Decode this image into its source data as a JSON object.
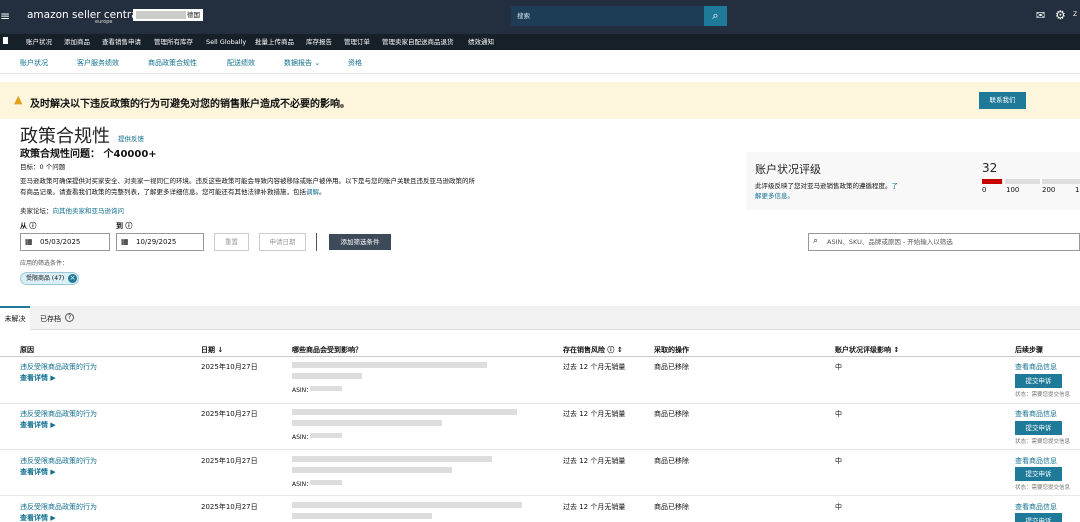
{
  "topbar": {
    "brand": "amazon seller central",
    "brand_sub": "europe",
    "account_country": "德国",
    "search_placeholder": "搜索",
    "user_initial": "Z"
  },
  "nav": [
    "账户状况",
    "添加商品",
    "查看销售申请",
    "管理所有库存",
    "Sell Globally",
    "批量上传商品",
    "库存报告",
    "管理订单",
    "管理卖家自配送商品退货",
    "绩效通知"
  ],
  "subnav": [
    "账户状况",
    "客户服务绩效",
    "商品政策合规性",
    "配送绩效",
    "数据报告 ⌄",
    "资格"
  ],
  "banner": {
    "text": "及时解决以下违反政策的行为可避免对您的销售账户造成不必要的影响。",
    "contact_label": "联系我们"
  },
  "page": {
    "title": "政策合规性",
    "feedback_link": "提供反馈",
    "issues_line": "政策合规性问题： 个40000+",
    "target_line": "目标：0 个问题",
    "desc_line1": "亚马逊政策可确保提供对买家安全、对卖家一视同仁的环境。违反这些政策可能会导致内容被移除或账户被停用。以下是与您的账户关联且违反亚马逊政策的所",
    "desc_line2_prefix": "有商品记录。请查看我们政策的完整列表，了解更多详细信息。您可能还有其他法律补救措施，包括",
    "desc_line2_link": "调解",
    "forum_prefix": "卖家论坛：",
    "forum_link": "向其他卖家和亚马逊询问"
  },
  "health": {
    "title": "账户状况评级",
    "desc_line1_prefix": "此评级反映了您对亚马逊销售政策的遵循程度。",
    "desc_line1_link": "了",
    "desc_line2": "解更多信息。",
    "score": "32",
    "score_fraction": 0.32,
    "ticks": [
      "0",
      "100",
      "200",
      "1"
    ]
  },
  "filters": {
    "from_label": "从 ⓘ",
    "to_label": "到 ⓘ",
    "from_date": "05/03/2025",
    "to_date": "10/29/2025",
    "reset_label": "重置",
    "appeal_date_label": "申请日期",
    "add_filter_label": "添加筛选条件",
    "search_placeholder": "ASIN、SKU、品牌或原因 - 开始输入以筛选",
    "applied_label": "应用的筛选条件：",
    "chip_label": "受限商品 (47)"
  },
  "tabs": {
    "active": "未解决",
    "archived": "已存档"
  },
  "table": {
    "headers": {
      "reason": "原因",
      "date": "日期 ↓",
      "affected": "哪些商品会受到影响？",
      "risk": "存在销售风险 ⓘ ↕",
      "action": "采取的操作",
      "impact": "账户状况评级影响 ↕",
      "next": "后续步骤"
    },
    "rows": [
      {
        "reason": "违反受限商品政策的行为",
        "detail": "查看详情 ▶",
        "date": "2025年10月27日",
        "asin": "ASIN：",
        "risk": "过去 12 个月无销量",
        "action": "商品已移除",
        "impact": "中",
        "view_info": "查看商品信息",
        "appeal": "提交申诉",
        "status": "状态：需要您提交信息"
      },
      {
        "reason": "违反受限商品政策的行为",
        "detail": "查看详情 ▶",
        "date": "2025年10月27日",
        "asin": "ASIN：",
        "risk": "过去 12 个月无销量",
        "action": "商品已移除",
        "impact": "中",
        "view_info": "查看商品信息",
        "appeal": "提交申诉",
        "status": "状态：需要您提交信息"
      },
      {
        "reason": "违反受限商品政策的行为",
        "detail": "查看详情 ▶",
        "date": "2025年10月27日",
        "asin": "ASIN：",
        "risk": "过去 12 个月无销量",
        "action": "商品已移除",
        "impact": "中",
        "view_info": "查看商品信息",
        "appeal": "提交申诉",
        "status": "状态：需要您提交信息"
      },
      {
        "reason": "违反受限商品政策的行为",
        "detail": "查看详情 ▶",
        "date": "2025年10月27日",
        "asin": "ASIN：",
        "risk": "过去 12 个月无销量",
        "action": "商品已移除",
        "impact": "中",
        "view_info": "查看商品信息",
        "appeal": "提交申诉",
        "status": ""
      }
    ]
  },
  "colors": {
    "topbar": "#232f3e",
    "accent": "#1f7a99",
    "banner": "#fdf6dd",
    "warning": "#e0a21d",
    "score_bar": "#c40000"
  },
  "icons": [
    "menu-icon",
    "search-icon",
    "mail-icon",
    "gear-icon",
    "warning-icon",
    "calendar-icon",
    "close-icon",
    "info-icon"
  ]
}
